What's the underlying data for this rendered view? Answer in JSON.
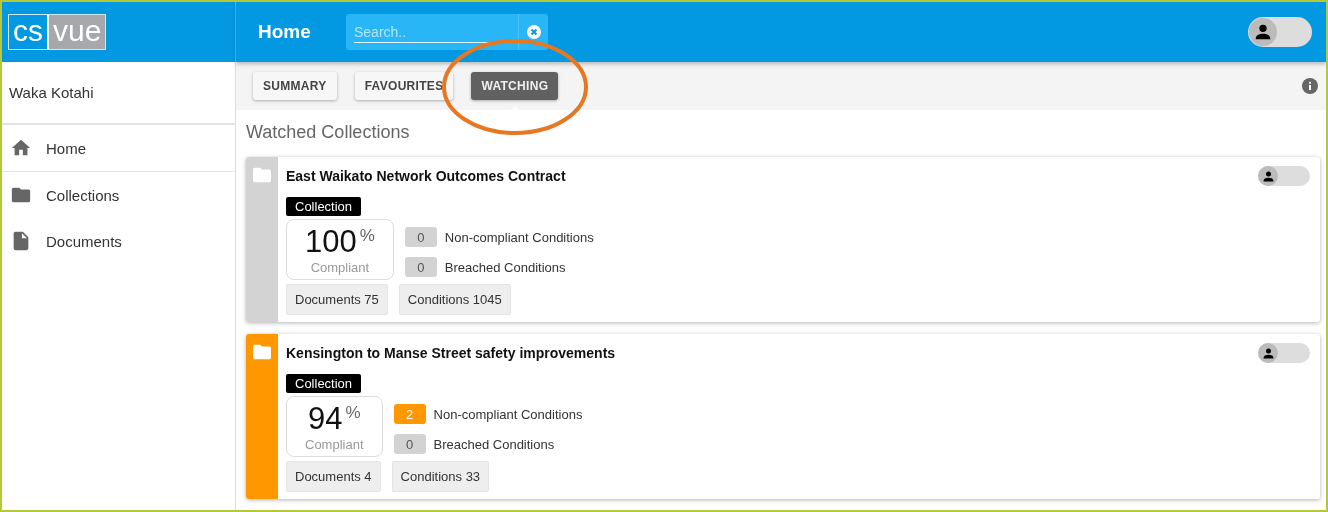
{
  "logo": {
    "left": "cs",
    "right": "vue"
  },
  "header": {
    "title": "Home",
    "search": {
      "placeholder": "Search.."
    },
    "user_toggle": {
      "on": false
    }
  },
  "sidebar": {
    "organisation": "Waka Kotahi",
    "items": [
      {
        "label": "Home",
        "kind": "home",
        "selected": true
      },
      {
        "label": "Collections",
        "kind": "folder",
        "selected": false
      },
      {
        "label": "Documents",
        "kind": "document",
        "selected": false
      }
    ]
  },
  "tabs": [
    {
      "label": "SUMMARY",
      "selected": false
    },
    {
      "label": "FAVOURITES",
      "selected": false
    },
    {
      "label": "WATCHING",
      "selected": true
    }
  ],
  "section_title": "Watched Collections",
  "collections": [
    {
      "title": "East Waikato Network Outcomes Contract",
      "toggle_on": false,
      "color": "#d3d3d3",
      "type": "Collection",
      "percent": "100",
      "percent_sign": "%",
      "compliance_label": "Compliant",
      "conditions": [
        {
          "count": "0",
          "label": "Non-compliant Conditions",
          "color": "#d3d3d3"
        },
        {
          "count": "0",
          "label": "Breached Conditions",
          "color": "#d3d3d3"
        }
      ],
      "chips": [
        "Documents 75",
        "Conditions 1045"
      ]
    },
    {
      "title": "Kensington to Manse Street safety improvements",
      "toggle_on": false,
      "color": "#ff9800",
      "type": "Collection",
      "percent": "94",
      "percent_sign": "%",
      "compliance_label": "Compliant",
      "conditions": [
        {
          "count": "2",
          "label": "Non-compliant Conditions",
          "color": "#ff9800"
        },
        {
          "count": "0",
          "label": "Breached Conditions",
          "color": "#d3d3d3"
        }
      ],
      "chips": [
        "Documents 4",
        "Conditions 33"
      ]
    }
  ]
}
